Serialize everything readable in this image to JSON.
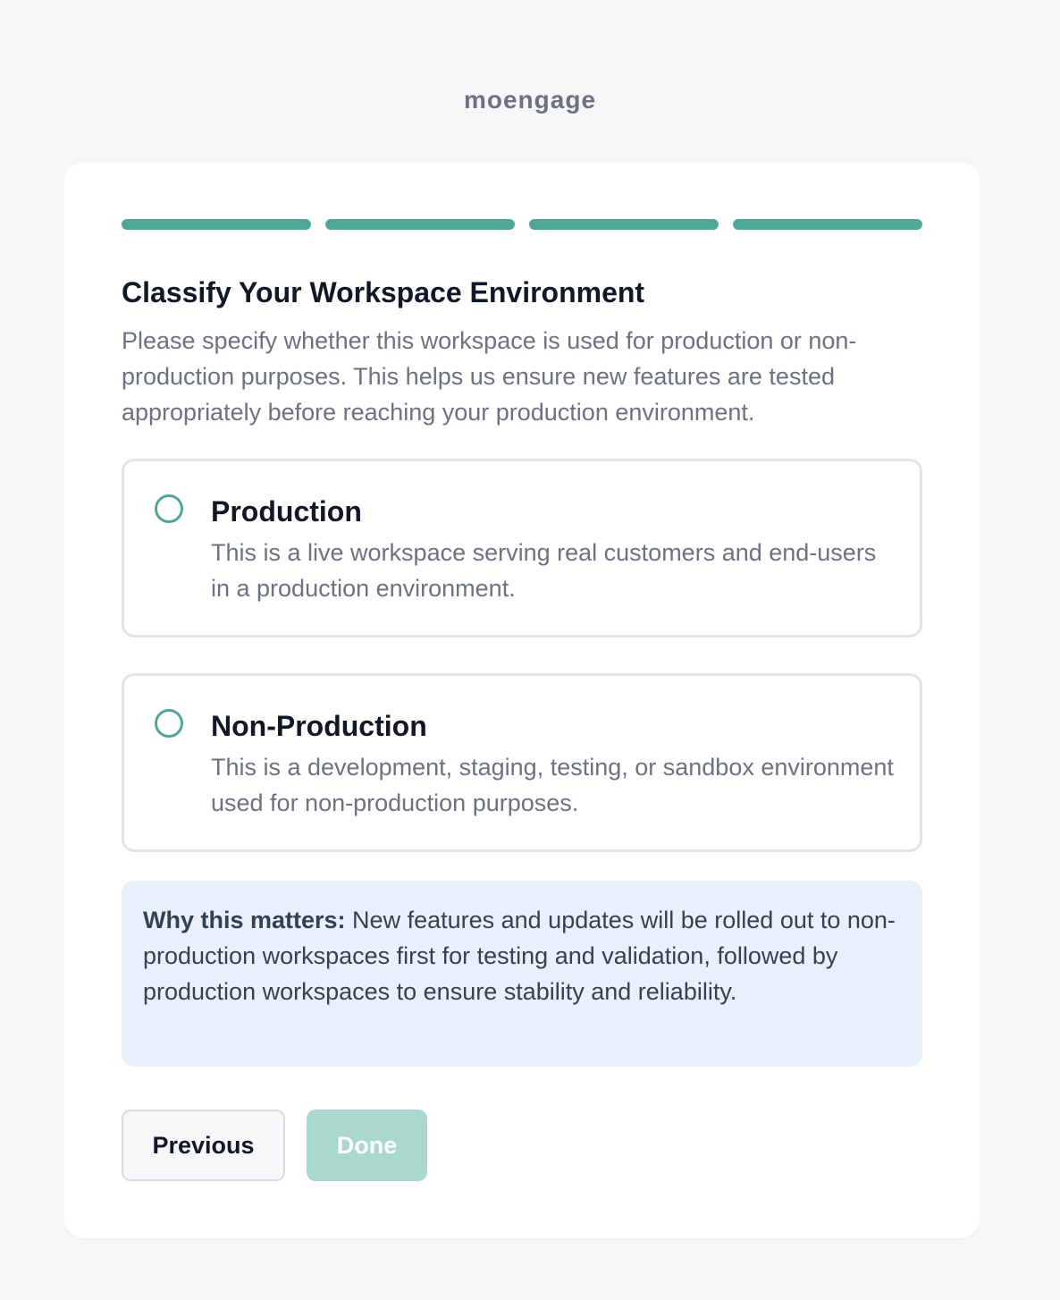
{
  "brand": {
    "name": "moengage"
  },
  "progress": {
    "total_steps": 4,
    "completed_steps": 4,
    "accent_color": "#4fa796"
  },
  "step": {
    "title": "Classify Your Workspace Environment",
    "description": "Please specify whether this workspace is used for production or non-production purposes. This helps us ensure new features are tested appropriately before reaching your production environment."
  },
  "options": [
    {
      "label": "Production",
      "description": "This is a live workspace serving real customers and end-users in a production environment.",
      "selected": false
    },
    {
      "label": "Non-Production",
      "description": "This is a development, staging, testing, or sandbox environment used for non-production purposes.",
      "selected": false
    }
  ],
  "info": {
    "lead": "Why this matters:",
    "body": " New features and updates will be rolled out to non-production workspaces first for testing and validation, followed by production workspaces to ensure stability and reliability."
  },
  "actions": {
    "previous_label": "Previous",
    "done_label": "Done",
    "done_enabled": false
  }
}
